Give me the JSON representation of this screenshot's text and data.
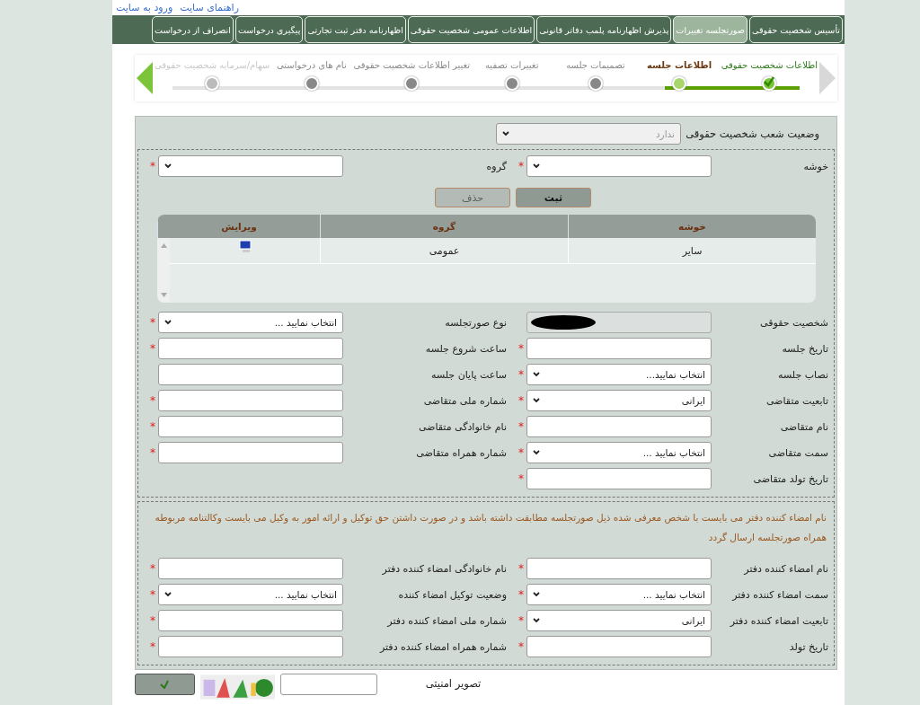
{
  "top_links": [
    "راهنمای سایت",
    "ورود به سایت"
  ],
  "tabs": [
    {
      "label": "تأسیس شخصیت حقوقی",
      "selected": false
    },
    {
      "label": "صورتجلسه تغییرات",
      "selected": true
    },
    {
      "label": "پذیرش اظهارنامه پلمب دفاتر قانونی",
      "selected": false
    },
    {
      "label": "اطلاعات عمومی شخصیت حقوقی",
      "selected": false
    },
    {
      "label": "اظهارنامه دفتر ثبت تجارتی",
      "selected": false
    },
    {
      "label": "پیگیری درخواست",
      "selected": false
    },
    {
      "label": "انصراف از درخواست",
      "selected": false
    }
  ],
  "steps": [
    {
      "label": "اطلاعات شخصیت حقوقی",
      "done": true,
      "selected": false,
      "faded": false
    },
    {
      "label": "اطلاعات جلسه",
      "done": false,
      "selected": true,
      "faded": false
    },
    {
      "label": "تصمیمات جلسه",
      "done": false,
      "selected": false,
      "faded": false
    },
    {
      "label": "تغییرات تصفیه",
      "done": false,
      "selected": false,
      "faded": false
    },
    {
      "label": "تغییر اطلاعات شخصیت حقوقی",
      "done": false,
      "selected": false,
      "faded": false
    },
    {
      "label": "نام های درخواستی",
      "done": false,
      "selected": false,
      "faded": false
    },
    {
      "label": "سهام/سرمایه شخصیت حقوقی",
      "done": false,
      "selected": false,
      "faded": true
    }
  ],
  "branch_status": {
    "label": "وضعیت شعب شخصیت حقوقی",
    "value": "ندارد",
    "disabled": true
  },
  "group_picker": {
    "fields": [
      {
        "label": "خوشه",
        "kind": "select",
        "mark": "*"
      },
      {
        "label": "گروه",
        "kind": "select",
        "mark": "*"
      }
    ],
    "buttons": [
      {
        "label": "ثبت",
        "disabled": false
      },
      {
        "label": "حذف",
        "disabled": true
      }
    ]
  },
  "table": {
    "columns": [
      "خوشه",
      "گروه",
      "ویرایش"
    ],
    "rows": [
      [
        "سایر",
        "عمومی"
      ]
    ]
  },
  "session_rows": [
    [
      {
        "label": "شخصیت حقوقی",
        "kind": "redacted"
      },
      {
        "label": "نوع صورتجلسه",
        "kind": "select",
        "value": "انتخاب نمایید ...",
        "mark": "*"
      }
    ],
    [
      {
        "label": "تاریخ جلسه",
        "kind": "text",
        "mark": "*"
      },
      {
        "label": "ساعت شروع جلسه",
        "kind": "text",
        "mark": "*"
      }
    ],
    [
      {
        "label": "نصاب جلسه",
        "kind": "select",
        "value": "انتخاب نمایید...",
        "mark": "*"
      },
      {
        "label": "ساعت پایان جلسه",
        "kind": "text"
      }
    ],
    [
      {
        "label": "تابعیت متقاضی",
        "kind": "select",
        "value": "ایرانی",
        "mark": "*"
      },
      {
        "label": "شماره ملی متقاضی",
        "kind": "text",
        "mark": "*"
      }
    ],
    [
      {
        "label": "نام متقاضی",
        "kind": "text",
        "mark": "*"
      },
      {
        "label": "نام خانوادگی متقاضی",
        "kind": "text",
        "mark": "*"
      }
    ],
    [
      {
        "label": "سمت متقاضی",
        "kind": "select",
        "value": "انتخاب نمایید ...",
        "mark": "*"
      },
      {
        "label": "شماره همراه متقاضی",
        "kind": "text",
        "mark": "*"
      }
    ],
    [
      {
        "label": "تاریخ تولد متقاضی",
        "kind": "text",
        "mark": "*"
      }
    ]
  ],
  "signer_notice": "نام امضاء کننده دفتر می بایست با شخص معرفی شده ذیل صورتجلسه مطابقت داشته باشد و در صورت داشتن حق توکیل و ارائه امور به وکیل می بایست وکالتنامه مربوطه همراه صورتجلسه ارسال گردد",
  "signer_rows": [
    [
      {
        "label": "نام امضاء کننده دفتر",
        "kind": "text",
        "mark": "*"
      },
      {
        "label": "نام خانوادگی امضاء کننده دفتر",
        "kind": "text",
        "mark": "*"
      }
    ],
    [
      {
        "label": "سمت امضاء کننده دفتر",
        "kind": "select",
        "value": "انتخاب نمایید ...",
        "mark": "*"
      },
      {
        "label": "وضعیت توکیل امضاء کننده",
        "kind": "select",
        "value": "انتخاب نمایید ...",
        "mark": "*"
      }
    ],
    [
      {
        "label": "تابعیت امضاء کننده دفتر",
        "kind": "select",
        "value": "ایرانی",
        "mark": "*"
      },
      {
        "label": "شماره ملی امضاء کننده دفتر",
        "kind": "text",
        "mark": "*"
      }
    ],
    [
      {
        "label": "تاریخ تولد",
        "kind": "text",
        "mark": "*"
      },
      {
        "label": "شماره همراه امضاء کننده دفتر",
        "kind": "text",
        "mark": "*"
      }
    ]
  ],
  "captcha": {
    "label": "تصویر امنیتی"
  }
}
